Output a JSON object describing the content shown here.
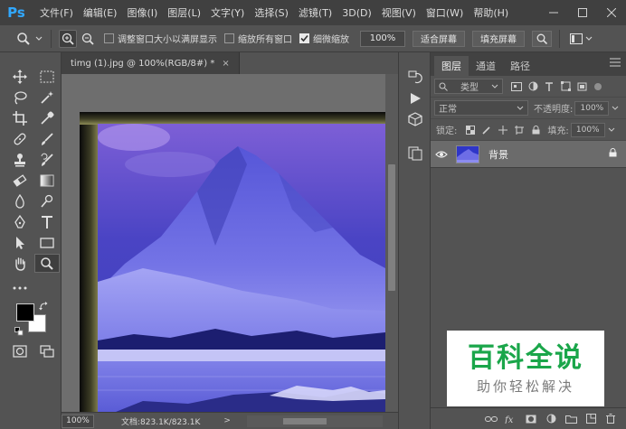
{
  "app": {
    "logo": "Ps",
    "menus": [
      "文件(F)",
      "编辑(E)",
      "图像(I)",
      "图层(L)",
      "文字(Y)",
      "选择(S)",
      "滤镜(T)",
      "3D(D)",
      "视图(V)",
      "窗口(W)",
      "帮助(H)"
    ]
  },
  "options": {
    "resize_windows": "调整窗口大小以满屏显示",
    "zoom_all_windows": "缩放所有窗口",
    "scrubby_zoom": "细微缩放",
    "zoom_value": "100%",
    "fit_screen": "适合屏幕",
    "fill_screen": "填充屏幕"
  },
  "document": {
    "tab_title": "timg (1).jpg @ 100%(RGB/8#) *",
    "close": "×"
  },
  "status": {
    "zoom": "100%",
    "doc_info": "文档:823.1K/823.1K",
    "arrow": ">"
  },
  "layers_panel": {
    "tabs": [
      "图层",
      "通道",
      "路径"
    ],
    "filter_kind": "类型",
    "blend_mode": "正常",
    "opacity_label": "不透明度:",
    "opacity_value": "100%",
    "lock_label": "锁定:",
    "fill_label": "填充:",
    "fill_value": "100%",
    "layers": [
      {
        "name": "背景"
      }
    ]
  },
  "watermark": {
    "title": "百科全说",
    "subtitle": "助你轻松解决"
  },
  "colors": {
    "brand": "#31a8ff",
    "watermark_green": "#1aa64a",
    "foreground": "#000000",
    "background": "#ffffff"
  }
}
